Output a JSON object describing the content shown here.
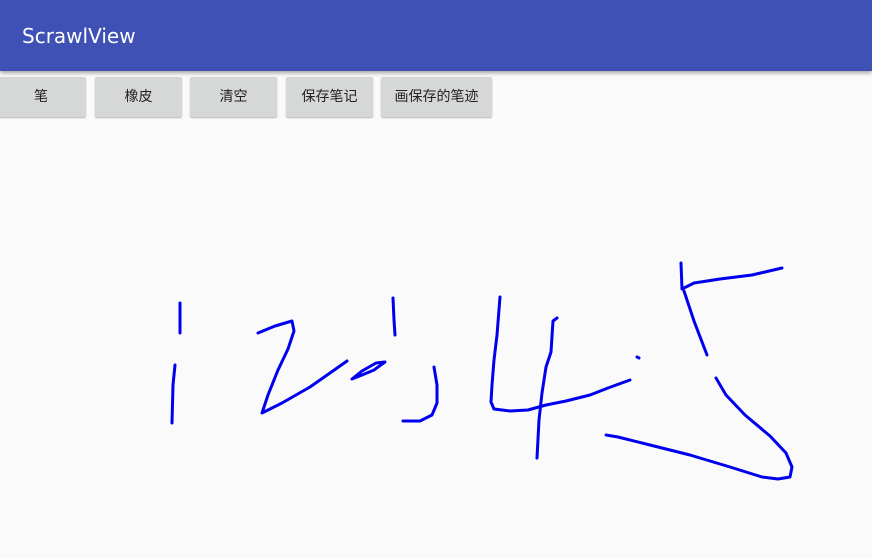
{
  "app": {
    "title": "ScrawlView",
    "accent_color": "#3f51b5"
  },
  "toolbar": {
    "pen_label": "笔",
    "eraser_label": "橡皮",
    "clear_label": "清空",
    "save_label": "保存笔记",
    "draw_saved_label": "画保存的笔迹"
  },
  "canvas": {
    "stroke_color": "#0000ee",
    "content": "handwritten strokes"
  }
}
